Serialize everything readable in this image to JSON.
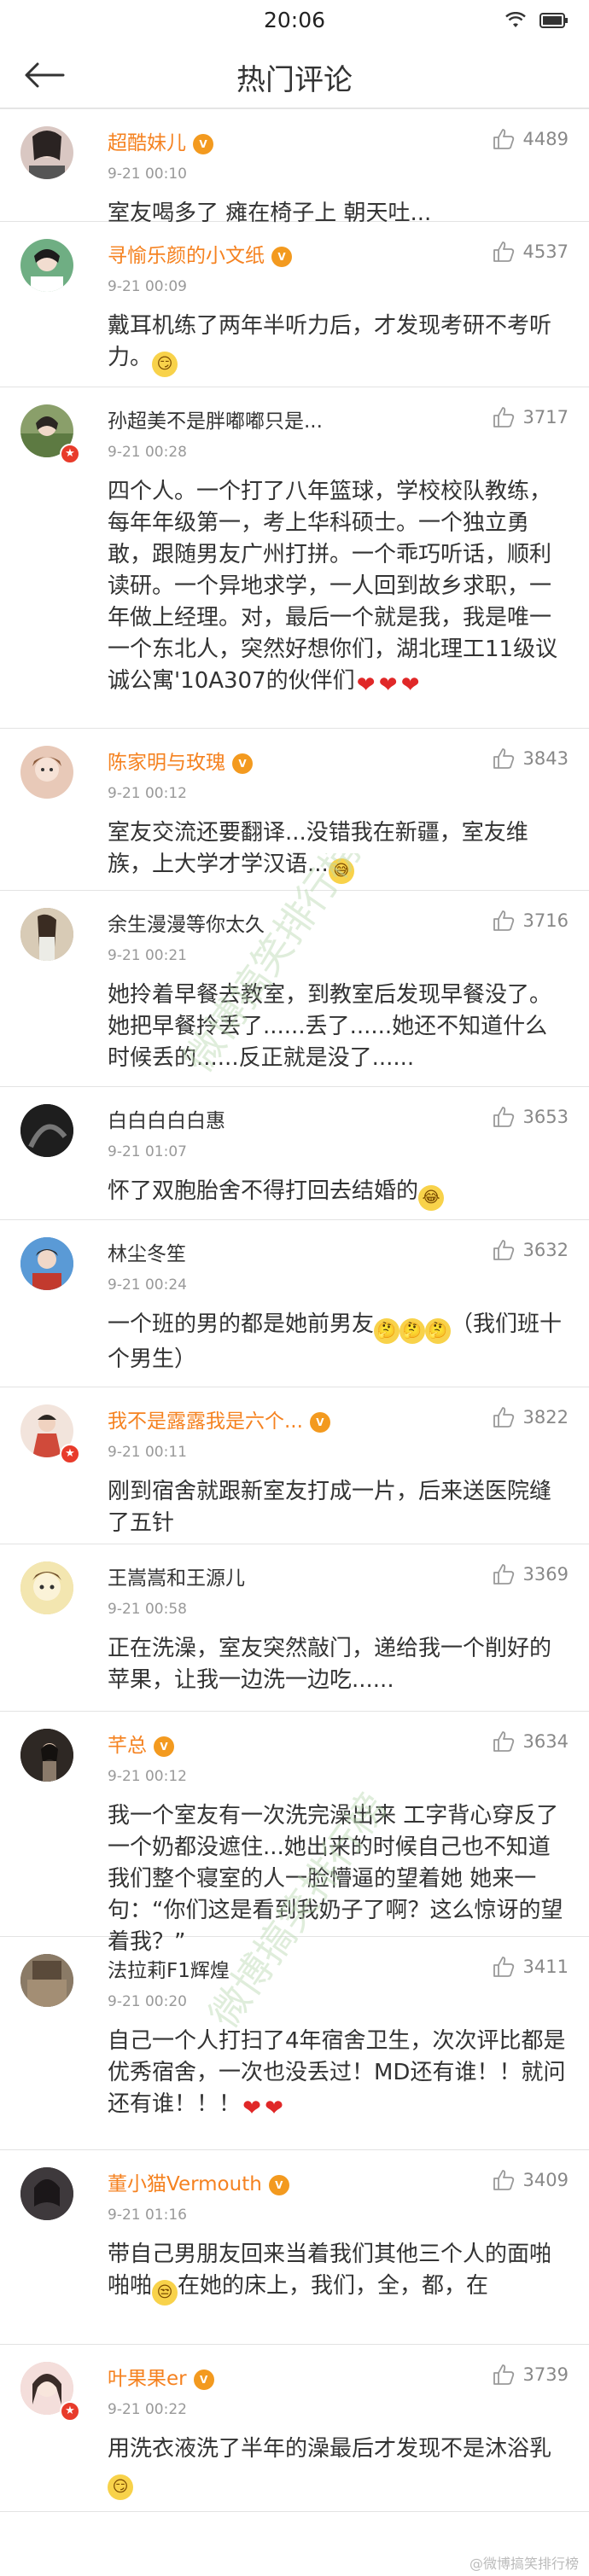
{
  "status_bar": {
    "time": "20:06"
  },
  "header": {
    "title": "热门评论"
  },
  "comments": [
    {
      "username": "超酷妹儿",
      "timestamp": "9-21 00:10",
      "likes": "4489",
      "text": "室友喝多了 瘫在椅子上 朝天吐...",
      "emojis": [],
      "orange": true,
      "vip": true,
      "verified": false,
      "avatar_color": "#d9c7c2"
    },
    {
      "username": "寻愉乐颜的小文纸",
      "timestamp": "9-21 00:09",
      "likes": "4537",
      "text": "戴耳机练了两年半听力后，才发现考研不考听力。",
      "emojis": [
        "😏"
      ],
      "orange": true,
      "vip": true,
      "verified": false,
      "avatar_color": "#6fae83"
    },
    {
      "username": "孙超美不是胖嘟嘟只是...",
      "timestamp": "9-21 00:28",
      "likes": "3717",
      "text": "四个人。一个打了八年篮球，学校校队教练，每年年级第一，考上华科硕士。一个独立勇敢，跟随男友广州打拼。一个乖巧听话，顺利读研。一个异地求学，一人回到故乡求职，一年做上经理。对，最后一个就是我，我是唯一一个东北人，突然好想你们，湖北理工11级议诚公寓'10A307的伙伴们",
      "emojis": [
        "❤",
        "❤",
        "❤"
      ],
      "orange": false,
      "vip": false,
      "verified": true,
      "avatar_color": "#8a9f6a"
    },
    {
      "username": "陈家明与玫瑰",
      "timestamp": "9-21 00:12",
      "likes": "3843",
      "text": "室友交流还要翻译...没错我在新疆，室友维族，上大学才学汉语...",
      "emojis": [
        "😅"
      ],
      "orange": true,
      "vip": true,
      "verified": false,
      "avatar_color": "#e8c9b8"
    },
    {
      "username": "余生漫漫等你太久",
      "timestamp": "9-21 00:21",
      "likes": "3716",
      "text": "她拎着早餐去教室，到教室后发现早餐没了。她把早餐拎丢了......丢了......她还不知道什么时候丢的......反正就是没了......",
      "emojis": [],
      "orange": false,
      "vip": false,
      "verified": false,
      "avatar_color": "#b9a58c"
    },
    {
      "username": "白白白白白惠",
      "timestamp": "9-21 01:07",
      "likes": "3653",
      "text": "怀了双胞胎舍不得打回去结婚的",
      "emojis": [
        "😂"
      ],
      "orange": false,
      "vip": false,
      "verified": false,
      "avatar_color": "#2a2a2a"
    },
    {
      "username": "林尘冬笙",
      "timestamp": "9-21 00:24",
      "likes": "3632",
      "text": "一个班的男的都是她前男友",
      "text_after": "（我们班十个男生）",
      "emojis": [
        "🤔",
        "🤔",
        "🤔"
      ],
      "orange": false,
      "vip": false,
      "verified": false,
      "avatar_color": "#c23a2e"
    },
    {
      "username": "我不是露露我是六个...",
      "timestamp": "9-21 00:11",
      "likes": "3822",
      "text": "刚到宿舍就跟新室友打成一片，后来送医院缝了五针",
      "emojis": [],
      "orange": true,
      "vip": true,
      "verified": true,
      "avatar_color": "#d04a3a"
    },
    {
      "username": "王嵩嵩和王源儿",
      "timestamp": "9-21 00:58",
      "likes": "3369",
      "text": "正在洗澡，室友突然敲门，递给我一个削好的苹果，让我一边洗一边吃......",
      "emojis": [],
      "orange": false,
      "vip": false,
      "verified": false,
      "avatar_color": "#e8d48a"
    },
    {
      "username": "芊总",
      "timestamp": "9-21 00:12",
      "likes": "3634",
      "text": "我一个室友有一次洗完澡出来 工字背心穿反了 一个奶都没遮住...她出来的时候自己也不知道 我们整个寝室的人一脸懵逼的望着她 她来一句：“你们这是看到我奶子了啊？这么惊讶的望着我？”",
      "emojis": [],
      "orange": true,
      "vip": true,
      "verified": false,
      "avatar_color": "#3b3530"
    },
    {
      "username": "法拉莉F1辉煌",
      "timestamp": "9-21 00:20",
      "likes": "3411",
      "text": "自己一个人打扫了4年宿舍卫生，次次评比都是优秀宿舍，一次也没丢过！MD还有谁！！就问还有谁！！！",
      "emojis": [
        "❤",
        "❤"
      ],
      "orange": false,
      "vip": false,
      "verified": false,
      "avatar_color": "#6a5a4a"
    },
    {
      "username": "董小猫Vermouth",
      "timestamp": "9-21 01:16",
      "likes": "3409",
      "text": "带自己男朋友回来当着我们其他三个人的面啪啪啪",
      "text_after": "在她的床上，我们，全，都，在",
      "emojis": [
        "😒"
      ],
      "orange": true,
      "vip": true,
      "verified": false,
      "avatar_color": "#4a4548"
    },
    {
      "username": "叶果果er",
      "timestamp": "9-21 00:22",
      "likes": "3739",
      "text": "用洗衣液洗了半年的澡最后才发现不是沐浴乳",
      "emojis": [
        "😏"
      ],
      "orange": true,
      "vip": true,
      "verified": true,
      "avatar_color": "#e9c5c0"
    }
  ],
  "watermark": {
    "text": "微博搞笑排行榜"
  },
  "footer": {
    "watermark": "@微博搞笑排行榜"
  },
  "colors": {
    "orange_name": "#f58220",
    "vip": "#f39a1f",
    "heart": "#e02828",
    "verified": "#e83b2b"
  }
}
